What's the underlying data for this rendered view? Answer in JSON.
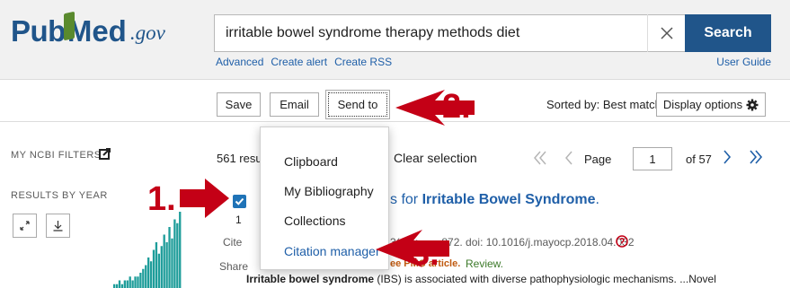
{
  "header": {
    "logo_pub": "Pub",
    "logo_med": "Med",
    "logo_gov": ".gov",
    "search_value": "irritable bowel syndrome therapy methods diet",
    "search_button": "Search",
    "links": [
      "Advanced",
      "Create alert",
      "Create RSS"
    ],
    "user_guide": "User Guide"
  },
  "toolbar": {
    "save": "Save",
    "email": "Email",
    "send_to": "Send to",
    "sorted_by": "Sorted by: Best match",
    "display_options": "Display options"
  },
  "left_panel": {
    "my_ncbi_filters": "MY NCBI FILTERS",
    "results_by_year": "RESULTS BY YEAR",
    "histogram_values": [
      1,
      1,
      2,
      1,
      2,
      2,
      3,
      2,
      3,
      3,
      4,
      5,
      6,
      8,
      7,
      10,
      12,
      9,
      11,
      14,
      12,
      16,
      13,
      18,
      17,
      20
    ]
  },
  "results": {
    "count_partial": "561 resul",
    "clear_selection": "Clear selection",
    "page_label": "Page",
    "page_value": "1",
    "of_pages": "of 57",
    "item_number": "1",
    "cite": "Cite",
    "share": "Share",
    "title_prefix": "s for ",
    "title_bold": "Irritable Bowel Syndrome",
    "title_suffix": ".",
    "citation_partial": "3(12):",
    "citation_rest": "872. doi: 10.1016/j.mayocp.2018.04.032",
    "free_pmc_partial": "ee PMC article.",
    "review": "Review.",
    "snippet_bold": "Irritable bowel syndrome",
    "snippet_rest": " (IBS) is associated with diverse pathophysiologic mechanisms. ...Novel"
  },
  "dropdown": {
    "items": [
      "Clipboard",
      "My Bibliography",
      "Collections",
      "Citation manager"
    ]
  },
  "annotations": {
    "step1": "1.",
    "step2": "2.",
    "step3": "3."
  },
  "colors": {
    "brand": "#20558a",
    "annotation": "#c40016",
    "link": "#1f5fa8"
  }
}
